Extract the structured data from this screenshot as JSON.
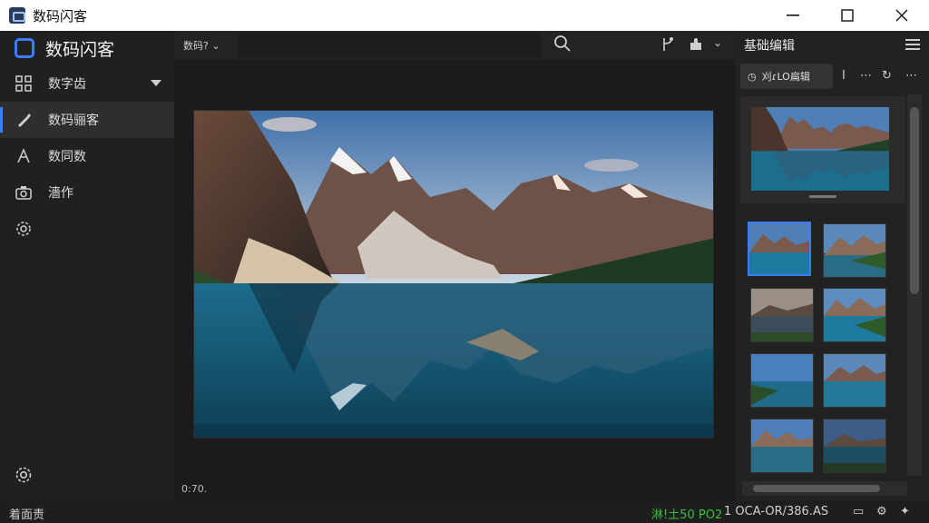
{
  "window": {
    "title": "数码闪客"
  },
  "sidebar": {
    "brand": "数码闪客",
    "items": [
      {
        "label": "数字齿",
        "icon": "grid-icon",
        "expand": true
      },
      {
        "label": "数码骊客",
        "icon": "brush-icon",
        "active": true
      },
      {
        "label": "数同数",
        "icon": "type-icon"
      },
      {
        "label": "濇作",
        "icon": "camera-icon"
      },
      {
        "label": "",
        "icon": "gear-icon"
      }
    ]
  },
  "toolbar": {
    "dropdown_label": "数码?",
    "search_placeholder": ""
  },
  "canvas": {
    "zoom_label": "0:70."
  },
  "right_panel": {
    "title": "基础编辑",
    "ai_button_label": "刈ɾLO扁辑"
  },
  "statusbar": {
    "left_text": "着面责",
    "green_text": "淋!土50 PO2",
    "right_text": "1 OCA-OR/386.AS"
  },
  "colors": {
    "accent": "#3d7bff",
    "status_green": "#33c13b"
  }
}
